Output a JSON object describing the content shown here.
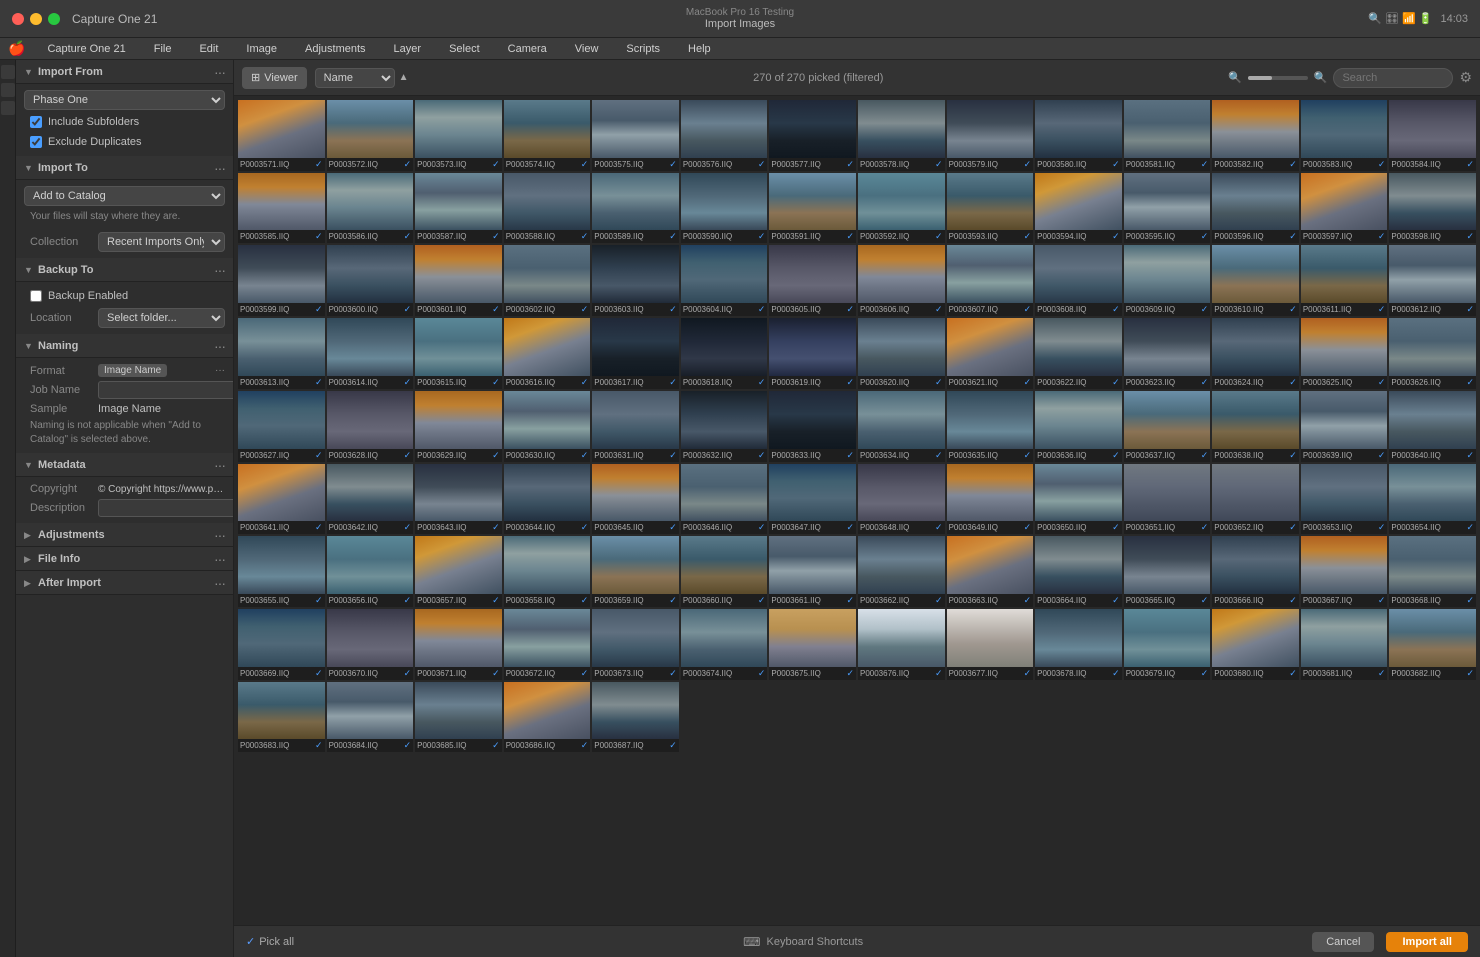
{
  "app": {
    "name": "Capture One 21",
    "device": "MacBook Pro 16 Testing",
    "window_title": "Import Images",
    "time": "14:03"
  },
  "menu": {
    "items": [
      "File",
      "Edit",
      "Image",
      "Adjustments",
      "Layer",
      "Select",
      "Camera",
      "View",
      "Scripts",
      "Help"
    ]
  },
  "toolbar": {
    "viewer_label": "Viewer",
    "name_label": "Name",
    "sort_icon": "▲",
    "status": "270 of 270 picked (filtered)",
    "search_placeholder": "Search",
    "settings_icon": "⚙"
  },
  "sidebar": {
    "import_from": {
      "title": "Import From",
      "dots": "...",
      "source": "Phase One",
      "include_subfolders": true,
      "exclude_duplicates": true
    },
    "import_to": {
      "title": "Import To",
      "dots": "...",
      "option": "Add to Catalog",
      "info": "Your files will stay where they are.",
      "collection_label": "Collection",
      "collection_value": "Recent Imports Only"
    },
    "backup_to": {
      "title": "Backup To",
      "dots": "...",
      "enabled": "Backup Enabled",
      "location_label": "Location",
      "location_placeholder": "Select folder..."
    },
    "naming": {
      "title": "Naming",
      "dots": "...",
      "format_label": "Format",
      "format_value": "Image Name",
      "job_name_label": "Job Name",
      "job_name_value": "",
      "sample_label": "Sample",
      "sample_value": "Image Name",
      "note": "Naming is not applicable when \"Add to Catalog\" is selected above."
    },
    "metadata": {
      "title": "Metadata",
      "dots": "...",
      "copyright_label": "Copyright",
      "copyright_value": "© Copyright https://www.paulreiffer",
      "description_label": "Description"
    },
    "adjustments": {
      "title": "Adjustments",
      "dots": "..."
    },
    "file_info": {
      "title": "File Info",
      "dots": "..."
    },
    "after_import": {
      "title": "After Import",
      "dots": "..."
    }
  },
  "bottom_bar": {
    "keyboard_label": "Keyboard Shortcuts",
    "pick_all_label": "Pick all",
    "cancel_label": "Cancel",
    "import_label": "Import all"
  },
  "images": {
    "count": 270,
    "picked": 270,
    "rows": [
      [
        "P0003571.IIQ",
        "P0003572.IIQ",
        "P0003573.IIQ",
        "P0003574.IIQ",
        "P0003575.IIQ",
        "P0003576.IIQ",
        "P0003577.IIQ",
        "P0003578.IIQ",
        "P0003579.IIQ",
        "P0003580.IIQ",
        "P0003581.IIQ",
        "P0003582.IIQ",
        "P0003583.IIQ",
        "P0003584.IIQ"
      ],
      [
        "P0003585.IIQ",
        "P0003586.IIQ",
        "P0003587.IIQ",
        "P0003588.IIQ",
        "P0003589.IIQ",
        "P0003590.IIQ",
        "P0003591.IIQ",
        "P0003592.IIQ",
        "P0003593.IIQ",
        "P0003594.IIQ",
        "P0003595.IIQ",
        "P0003596.IIQ",
        "P0003597.IIQ",
        "P0003598.IIQ"
      ],
      [
        "P0003599.IIQ",
        "P0003600.IIQ",
        "P0003601.IIQ",
        "P0003602.IIQ",
        "P0003603.IIQ",
        "P0003604.IIQ",
        "P0003605.IIQ",
        "P0003606.IIQ",
        "P0003607.IIQ",
        "P0003608.IIQ",
        "P0003609.IIQ",
        "P0003610.IIQ",
        "P0003611.IIQ",
        "P0003612.IIQ"
      ],
      [
        "P0003613.IIQ",
        "P0003614.IIQ",
        "P0003615.IIQ",
        "P0003616.IIQ",
        "P0003617.IIQ",
        "P0003618.IIQ",
        "P0003619.IIQ",
        "P0003620.IIQ",
        "P0003621.IIQ",
        "P0003622.IIQ",
        "P0003623.IIQ",
        "P0003624.IIQ",
        "P0003625.IIQ",
        "P0003626.IIQ"
      ],
      [
        "P0003627.IIQ",
        "P0003628.IIQ",
        "P0003629.IIQ",
        "P0003630.IIQ",
        "P0003631.IIQ",
        "P0003632.IIQ",
        "P0003633.IIQ",
        "P0003634.IIQ",
        "P0003635.IIQ",
        "P0003636.IIQ",
        "P0003637.IIQ",
        "P0003638.IIQ",
        "P0003639.IIQ",
        "P0003640.IIQ"
      ],
      [
        "P0003641.IIQ",
        "P0003642.IIQ",
        "P0003643.IIQ",
        "P0003644.IIQ",
        "P0003645.IIQ",
        "P0003646.IIQ",
        "P0003647.IIQ",
        "P0003648.IIQ",
        "P0003649.IIQ",
        "P0003650.IIQ",
        "P0003651.IIQ",
        "P0003652.IIQ",
        "P0003653.IIQ",
        "P0003654.IIQ"
      ],
      [
        "P0003655.IIQ",
        "P0003656.IIQ",
        "P0003657.IIQ",
        "P0003658.IIQ",
        "P0003659.IIQ",
        "P0003660.IIQ",
        "P0003661.IIQ",
        "P0003662.IIQ",
        "P0003663.IIQ",
        "P0003664.IIQ",
        "P0003665.IIQ",
        "P0003666.IIQ",
        "P0003667.IIQ",
        "P0003668.IIQ"
      ],
      [
        "P0003669.IIQ",
        "P0003670.IIQ",
        "P0003671.IIQ",
        "P0003672.IIQ",
        "P0003673.IIQ",
        "P0003674.IIQ",
        "P0003675.IIQ",
        "P0003676.IIQ",
        "P0003677.IIQ",
        "P0003678.IIQ",
        "P0003679.IIQ",
        "P0003680.IIQ",
        "P0003681.IIQ",
        "P0003682.IIQ"
      ],
      [
        "P0003683.IIQ",
        "P0003684.IIQ",
        "P0003685.IIQ",
        "P0003686.IIQ",
        "P0003687.IIQ",
        "",
        "",
        "",
        "",
        "",
        "",
        "",
        "",
        ""
      ]
    ],
    "gradients": [
      [
        "t6",
        "t1",
        "t3",
        "t2",
        "t4",
        "t5",
        "dark2",
        "t7",
        "t8",
        "t9",
        "t11",
        "t10",
        "t12",
        "t13"
      ],
      [
        "t14",
        "t3",
        "t15",
        "t16",
        "t17",
        "t18",
        "t1",
        "t19",
        "t2",
        "t20",
        "t4",
        "t5",
        "t6",
        "t7"
      ],
      [
        "t8",
        "t9",
        "t10",
        "t11",
        "dark1",
        "t12",
        "t13",
        "t14",
        "t15",
        "t16",
        "t3",
        "t1",
        "t2",
        "t4"
      ],
      [
        "t17",
        "t18",
        "t19",
        "t20",
        "dark2",
        "dark3",
        "dark4",
        "t5",
        "t6",
        "t7",
        "t8",
        "t9",
        "t10",
        "t11"
      ],
      [
        "t12",
        "t13",
        "t14",
        "t15",
        "t16",
        "dark1",
        "dark2",
        "t17",
        "t18",
        "t3",
        "t1",
        "t2",
        "t4",
        "t5"
      ],
      [
        "t6",
        "t7",
        "t8",
        "t9",
        "t10",
        "t11",
        "t12",
        "t13",
        "t14",
        "t15",
        "grey1",
        "grey1",
        "t16",
        "t17"
      ],
      [
        "t18",
        "t19",
        "t20",
        "t3",
        "t1",
        "t2",
        "t4",
        "t5",
        "t6",
        "t7",
        "t8",
        "t9",
        "t10",
        "t11"
      ],
      [
        "t12",
        "t13",
        "t14",
        "t15",
        "t16",
        "t17",
        "sand1",
        "cloud1",
        "white1",
        "t18",
        "t19",
        "t20",
        "t3",
        "t1"
      ],
      [
        "t2",
        "t4",
        "t5",
        "t6",
        "t7",
        "",
        "",
        "",
        "",
        "",
        "",
        "",
        "",
        ""
      ]
    ]
  }
}
